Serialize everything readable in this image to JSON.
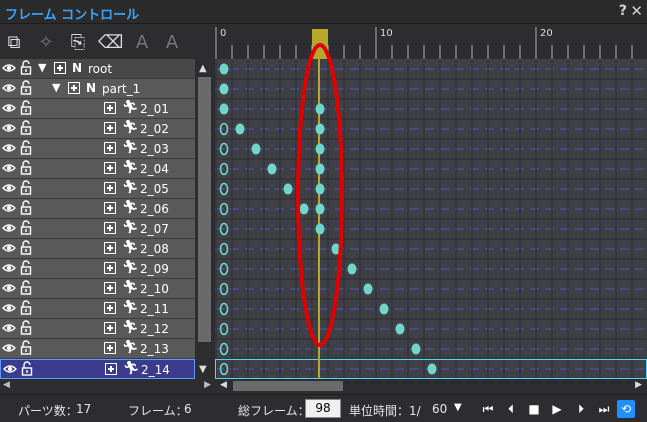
{
  "window": {
    "title": "フレーム コントロール",
    "help": "?",
    "close": "✕"
  },
  "toolbar": [
    {
      "name": "add-part-icon",
      "glyph": "⧉"
    },
    {
      "name": "add-disabled-icon",
      "glyph": "✧"
    },
    {
      "name": "copy-icon",
      "glyph": "⎘"
    },
    {
      "name": "erase-icon",
      "glyph": "⌫"
    },
    {
      "name": "text-a-icon",
      "glyph": "A"
    },
    {
      "name": "text-a-arrow-icon",
      "glyph": "A"
    }
  ],
  "tree": {
    "rows": [
      {
        "label": "root",
        "kind": "null",
        "expanded": true,
        "indent": 0
      },
      {
        "label": "part_1",
        "kind": "null",
        "expanded": true,
        "indent": 1
      },
      {
        "label": "2_01",
        "kind": "figure",
        "indent": 2
      },
      {
        "label": "2_02",
        "kind": "figure",
        "indent": 2
      },
      {
        "label": "2_03",
        "kind": "figure",
        "indent": 2
      },
      {
        "label": "2_04",
        "kind": "figure",
        "indent": 2
      },
      {
        "label": "2_05",
        "kind": "figure",
        "indent": 2
      },
      {
        "label": "2_06",
        "kind": "figure",
        "indent": 2
      },
      {
        "label": "2_07",
        "kind": "figure",
        "indent": 2
      },
      {
        "label": "2_08",
        "kind": "figure",
        "indent": 2
      },
      {
        "label": "2_09",
        "kind": "figure",
        "indent": 2
      },
      {
        "label": "2_10",
        "kind": "figure",
        "indent": 2
      },
      {
        "label": "2_11",
        "kind": "figure",
        "indent": 2
      },
      {
        "label": "2_12",
        "kind": "figure",
        "indent": 2
      },
      {
        "label": "2_13",
        "kind": "figure",
        "indent": 2
      },
      {
        "label": "2_14",
        "kind": "figure",
        "indent": 2,
        "selected": true
      }
    ]
  },
  "ruler": {
    "labels": [
      "0",
      "10",
      "20"
    ],
    "ticks_per_label": 10
  },
  "timeline": {
    "current_frame": 6,
    "rows": [
      {
        "open": [],
        "keys": [
          0
        ]
      },
      {
        "open": [],
        "keys": [
          0
        ]
      },
      {
        "open": [],
        "keys": [
          0,
          6
        ]
      },
      {
        "open": [
          0
        ],
        "keys": [
          1,
          6
        ]
      },
      {
        "open": [
          0
        ],
        "keys": [
          2,
          6
        ]
      },
      {
        "open": [
          0
        ],
        "keys": [
          3,
          6
        ]
      },
      {
        "open": [
          0
        ],
        "keys": [
          4,
          6
        ]
      },
      {
        "open": [
          0
        ],
        "keys": [
          5,
          6
        ]
      },
      {
        "open": [
          0
        ],
        "keys": [
          6
        ]
      },
      {
        "open": [
          0
        ],
        "keys": [
          7
        ]
      },
      {
        "open": [
          0
        ],
        "keys": [
          8
        ]
      },
      {
        "open": [
          0
        ],
        "keys": [
          9
        ]
      },
      {
        "open": [
          0
        ],
        "keys": [
          10
        ]
      },
      {
        "open": [
          0
        ],
        "keys": [
          11
        ]
      },
      {
        "open": [
          0
        ],
        "keys": [
          12
        ]
      },
      {
        "open": [
          0
        ],
        "keys": [
          13
        ]
      }
    ]
  },
  "colors": {
    "key": "#6fd7c9",
    "cursor": "#b5a82c",
    "highlight": "#e00000",
    "row_line": "#4b4b9a"
  },
  "status": {
    "parts_label": "パーツ数：",
    "parts_value": "17",
    "frame_label": "フレーム：",
    "frame_value": "6",
    "total_label": "総フレーム：",
    "total_value": "98",
    "unit_label": "単位時間：1/",
    "unit_value": "60",
    "unit_dropdown": "▼"
  },
  "playback": [
    "⏮",
    "⏴",
    "■",
    "▶",
    "⏵",
    "⏭",
    "⟲"
  ]
}
